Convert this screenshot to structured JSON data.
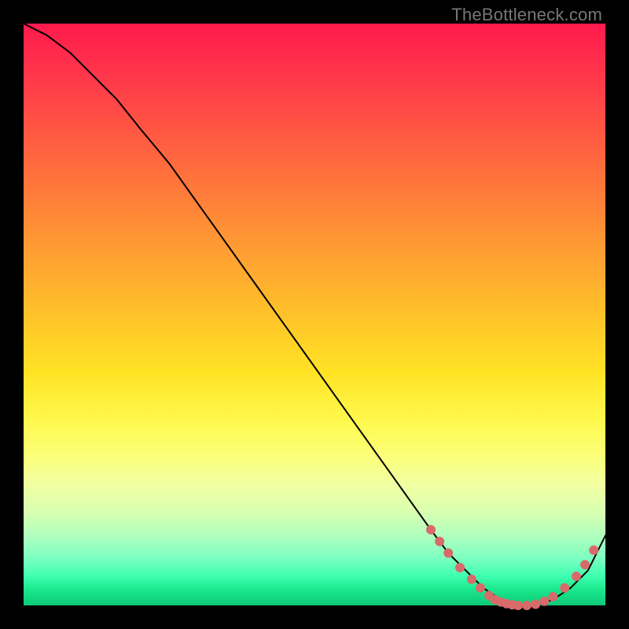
{
  "watermark": "TheBottleneck.com",
  "chart_data": {
    "type": "line",
    "title": "",
    "xlabel": "",
    "ylabel": "",
    "xlim": [
      0,
      100
    ],
    "ylim": [
      0,
      100
    ],
    "grid": false,
    "legend": false,
    "series": [
      {
        "name": "curve",
        "x": [
          0,
          4,
          8,
          12,
          16,
          20,
          25,
          30,
          35,
          40,
          45,
          50,
          55,
          60,
          65,
          70,
          73,
          76,
          79,
          82,
          85,
          88,
          91,
          94,
          97,
          100
        ],
        "y": [
          100,
          98,
          95,
          91,
          87,
          82,
          76,
          69,
          62,
          55,
          48,
          41,
          34,
          27,
          20,
          13,
          9,
          6,
          3,
          1,
          0,
          0,
          1,
          3,
          6,
          12
        ],
        "stroke": "#000000",
        "stroke_width": 2
      }
    ],
    "markers": {
      "name": "dots",
      "color": "#d86a6a",
      "radius": 6,
      "points": [
        {
          "x": 70.0,
          "y": 13.0
        },
        {
          "x": 71.5,
          "y": 11.0
        },
        {
          "x": 73.0,
          "y": 9.0
        },
        {
          "x": 75.0,
          "y": 6.5
        },
        {
          "x": 77.0,
          "y": 4.5
        },
        {
          "x": 78.5,
          "y": 3.0
        },
        {
          "x": 80.0,
          "y": 1.7
        },
        {
          "x": 81.0,
          "y": 1.0
        },
        {
          "x": 82.0,
          "y": 0.6
        },
        {
          "x": 83.0,
          "y": 0.3
        },
        {
          "x": 84.0,
          "y": 0.1
        },
        {
          "x": 85.0,
          "y": 0.0
        },
        {
          "x": 86.5,
          "y": 0.0
        },
        {
          "x": 88.0,
          "y": 0.2
        },
        {
          "x": 89.5,
          "y": 0.7
        },
        {
          "x": 91.0,
          "y": 1.5
        },
        {
          "x": 93.0,
          "y": 3.0
        },
        {
          "x": 95.0,
          "y": 5.0
        },
        {
          "x": 96.5,
          "y": 7.0
        },
        {
          "x": 98.0,
          "y": 9.5
        }
      ]
    }
  }
}
